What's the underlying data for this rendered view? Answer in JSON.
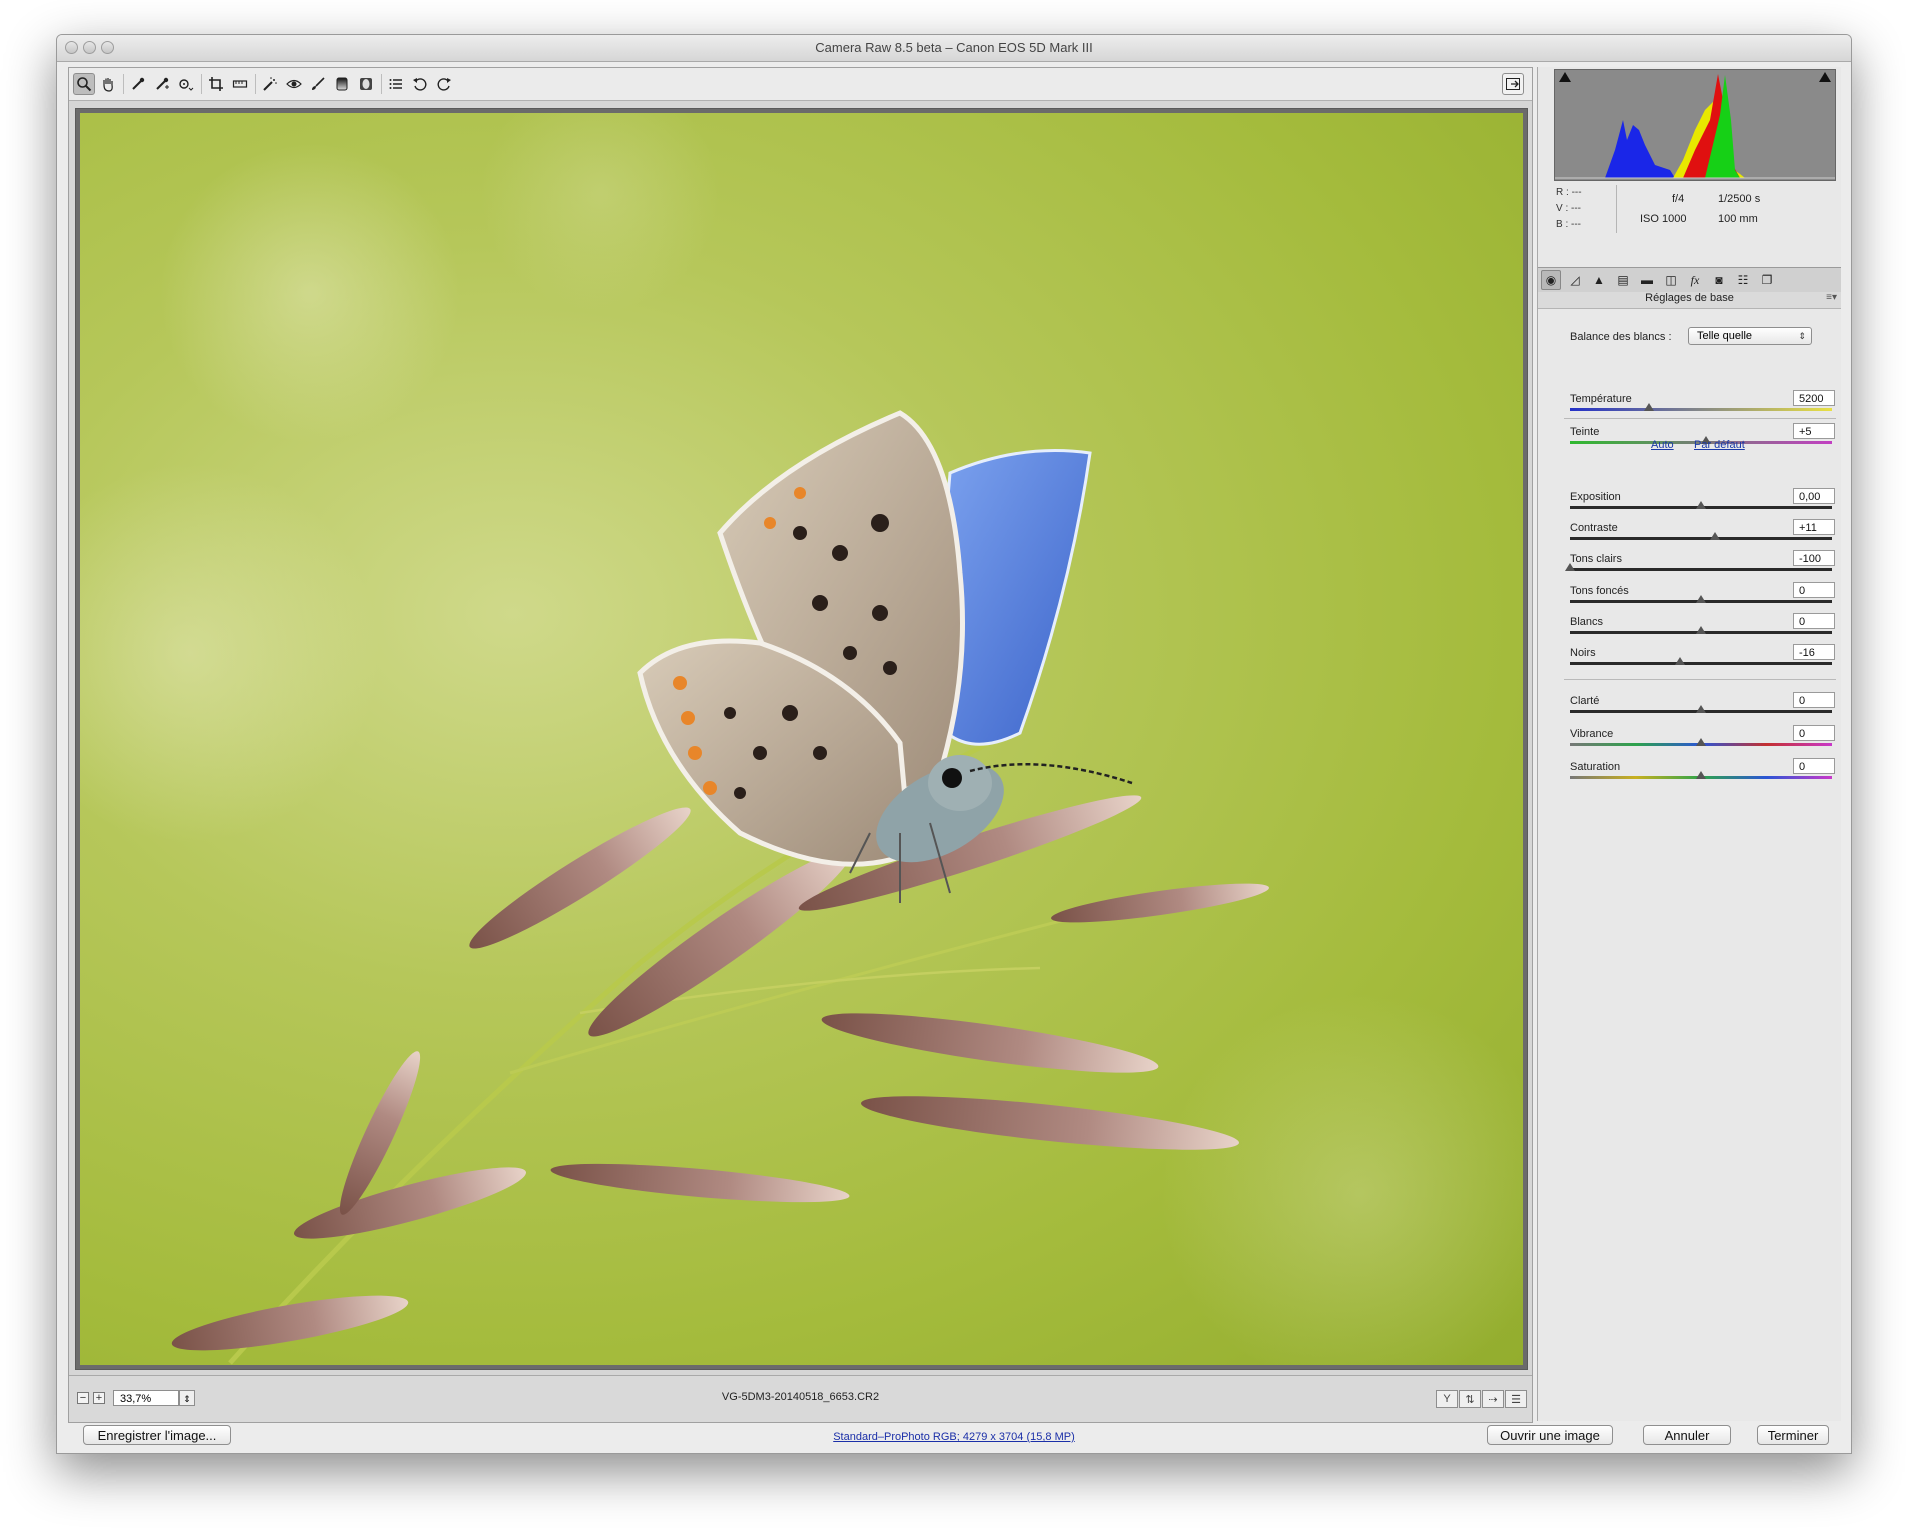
{
  "window": {
    "title": "Camera Raw 8.5 beta  –  Canon EOS 5D Mark III"
  },
  "toolbar": {
    "tools": [
      {
        "name": "zoom-tool",
        "icon": "magnifier-icon"
      },
      {
        "name": "hand-tool",
        "icon": "hand-icon"
      },
      {
        "name": "white-balance-tool",
        "icon": "eyedropper-icon"
      },
      {
        "name": "color-sampler-tool",
        "icon": "color-sampler-icon"
      },
      {
        "name": "targeted-adjustment-tool",
        "icon": "target-adjust-icon"
      },
      {
        "name": "crop-tool",
        "icon": "crop-icon"
      },
      {
        "name": "straighten-tool",
        "icon": "straighten-icon"
      },
      {
        "name": "spot-removal-tool",
        "icon": "spot-removal-icon"
      },
      {
        "name": "red-eye-tool",
        "icon": "red-eye-icon"
      },
      {
        "name": "adjustment-brush-tool",
        "icon": "brush-icon"
      },
      {
        "name": "graduated-filter-tool",
        "icon": "graduated-filter-icon"
      },
      {
        "name": "radial-filter-tool",
        "icon": "radial-filter-icon"
      },
      {
        "name": "preferences-button",
        "icon": "list-icon"
      },
      {
        "name": "rotate-left-button",
        "icon": "rotate-left-icon"
      },
      {
        "name": "rotate-right-button",
        "icon": "rotate-right-icon"
      }
    ],
    "fullscreen_icon": "fullscreen-icon"
  },
  "status": {
    "zoom_value": "33,7%",
    "filename": "VG-5DM3-20140518_6653.CR2"
  },
  "histogram": {
    "rgb_labels": [
      "R :",
      "V :",
      "B :"
    ],
    "rgb_values": [
      "---",
      "---",
      "---"
    ]
  },
  "exif": {
    "aperture": "f/4",
    "shutter": "1/2500 s",
    "iso": "ISO 1000",
    "focal": "100 mm"
  },
  "panel": {
    "title": "Réglages de base",
    "wb_label": "Balance des blancs :",
    "wb_value": "Telle quelle",
    "auto_link": "Auto",
    "default_link": "Par défaut",
    "sliders": [
      {
        "label": "Température",
        "value": "5200",
        "level": 0.3
      },
      {
        "label": "Teinte",
        "value": "+5",
        "level": 0.52
      },
      {
        "label": "Exposition",
        "value": "0,00",
        "level": 0.5
      },
      {
        "label": "Contraste",
        "value": "+11",
        "level": 0.555
      },
      {
        "label": "Tons clairs",
        "value": "-100",
        "level": 0.0
      },
      {
        "label": "Tons foncés",
        "value": "0",
        "level": 0.5
      },
      {
        "label": "Blancs",
        "value": "0",
        "level": 0.5
      },
      {
        "label": "Noirs",
        "value": "-16",
        "level": 0.42
      },
      {
        "label": "Clarté",
        "value": "0",
        "level": 0.5
      },
      {
        "label": "Vibrance",
        "value": "0",
        "level": 0.5
      },
      {
        "label": "Saturation",
        "value": "0",
        "level": 0.5
      }
    ]
  },
  "footer": {
    "save_label": "Enregistrer l'image...",
    "workflow_label": "Standard–ProPhoto RGB; 4279 x 3704 (15,8 MP)",
    "open_label": "Ouvrir une image",
    "cancel_label": "Annuler",
    "done_label": "Terminer"
  },
  "colors": {
    "link": "#1b3aa8",
    "photo_green": "#a4bb3c",
    "butterfly_blue": "#5b86e6"
  }
}
